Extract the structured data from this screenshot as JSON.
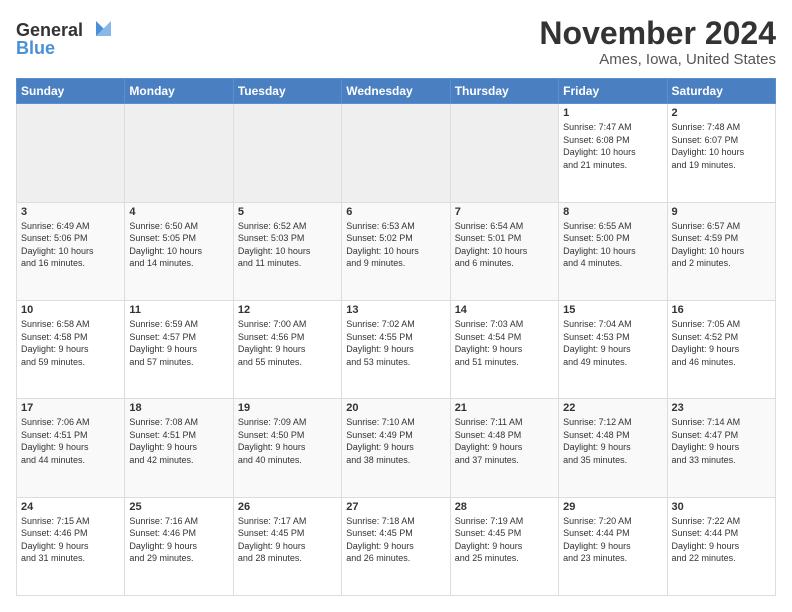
{
  "header": {
    "logo_line1": "General",
    "logo_line2": "Blue",
    "title": "November 2024",
    "subtitle": "Ames, Iowa, United States"
  },
  "calendar": {
    "headers": [
      "Sunday",
      "Monday",
      "Tuesday",
      "Wednesday",
      "Thursday",
      "Friday",
      "Saturday"
    ],
    "rows": [
      [
        {
          "day": "",
          "detail": ""
        },
        {
          "day": "",
          "detail": ""
        },
        {
          "day": "",
          "detail": ""
        },
        {
          "day": "",
          "detail": ""
        },
        {
          "day": "",
          "detail": ""
        },
        {
          "day": "1",
          "detail": "Sunrise: 7:47 AM\nSunset: 6:08 PM\nDaylight: 10 hours\nand 21 minutes."
        },
        {
          "day": "2",
          "detail": "Sunrise: 7:48 AM\nSunset: 6:07 PM\nDaylight: 10 hours\nand 19 minutes."
        }
      ],
      [
        {
          "day": "3",
          "detail": "Sunrise: 6:49 AM\nSunset: 5:06 PM\nDaylight: 10 hours\nand 16 minutes."
        },
        {
          "day": "4",
          "detail": "Sunrise: 6:50 AM\nSunset: 5:05 PM\nDaylight: 10 hours\nand 14 minutes."
        },
        {
          "day": "5",
          "detail": "Sunrise: 6:52 AM\nSunset: 5:03 PM\nDaylight: 10 hours\nand 11 minutes."
        },
        {
          "day": "6",
          "detail": "Sunrise: 6:53 AM\nSunset: 5:02 PM\nDaylight: 10 hours\nand 9 minutes."
        },
        {
          "day": "7",
          "detail": "Sunrise: 6:54 AM\nSunset: 5:01 PM\nDaylight: 10 hours\nand 6 minutes."
        },
        {
          "day": "8",
          "detail": "Sunrise: 6:55 AM\nSunset: 5:00 PM\nDaylight: 10 hours\nand 4 minutes."
        },
        {
          "day": "9",
          "detail": "Sunrise: 6:57 AM\nSunset: 4:59 PM\nDaylight: 10 hours\nand 2 minutes."
        }
      ],
      [
        {
          "day": "10",
          "detail": "Sunrise: 6:58 AM\nSunset: 4:58 PM\nDaylight: 9 hours\nand 59 minutes."
        },
        {
          "day": "11",
          "detail": "Sunrise: 6:59 AM\nSunset: 4:57 PM\nDaylight: 9 hours\nand 57 minutes."
        },
        {
          "day": "12",
          "detail": "Sunrise: 7:00 AM\nSunset: 4:56 PM\nDaylight: 9 hours\nand 55 minutes."
        },
        {
          "day": "13",
          "detail": "Sunrise: 7:02 AM\nSunset: 4:55 PM\nDaylight: 9 hours\nand 53 minutes."
        },
        {
          "day": "14",
          "detail": "Sunrise: 7:03 AM\nSunset: 4:54 PM\nDaylight: 9 hours\nand 51 minutes."
        },
        {
          "day": "15",
          "detail": "Sunrise: 7:04 AM\nSunset: 4:53 PM\nDaylight: 9 hours\nand 49 minutes."
        },
        {
          "day": "16",
          "detail": "Sunrise: 7:05 AM\nSunset: 4:52 PM\nDaylight: 9 hours\nand 46 minutes."
        }
      ],
      [
        {
          "day": "17",
          "detail": "Sunrise: 7:06 AM\nSunset: 4:51 PM\nDaylight: 9 hours\nand 44 minutes."
        },
        {
          "day": "18",
          "detail": "Sunrise: 7:08 AM\nSunset: 4:51 PM\nDaylight: 9 hours\nand 42 minutes."
        },
        {
          "day": "19",
          "detail": "Sunrise: 7:09 AM\nSunset: 4:50 PM\nDaylight: 9 hours\nand 40 minutes."
        },
        {
          "day": "20",
          "detail": "Sunrise: 7:10 AM\nSunset: 4:49 PM\nDaylight: 9 hours\nand 38 minutes."
        },
        {
          "day": "21",
          "detail": "Sunrise: 7:11 AM\nSunset: 4:48 PM\nDaylight: 9 hours\nand 37 minutes."
        },
        {
          "day": "22",
          "detail": "Sunrise: 7:12 AM\nSunset: 4:48 PM\nDaylight: 9 hours\nand 35 minutes."
        },
        {
          "day": "23",
          "detail": "Sunrise: 7:14 AM\nSunset: 4:47 PM\nDaylight: 9 hours\nand 33 minutes."
        }
      ],
      [
        {
          "day": "24",
          "detail": "Sunrise: 7:15 AM\nSunset: 4:46 PM\nDaylight: 9 hours\nand 31 minutes."
        },
        {
          "day": "25",
          "detail": "Sunrise: 7:16 AM\nSunset: 4:46 PM\nDaylight: 9 hours\nand 29 minutes."
        },
        {
          "day": "26",
          "detail": "Sunrise: 7:17 AM\nSunset: 4:45 PM\nDaylight: 9 hours\nand 28 minutes."
        },
        {
          "day": "27",
          "detail": "Sunrise: 7:18 AM\nSunset: 4:45 PM\nDaylight: 9 hours\nand 26 minutes."
        },
        {
          "day": "28",
          "detail": "Sunrise: 7:19 AM\nSunset: 4:45 PM\nDaylight: 9 hours\nand 25 minutes."
        },
        {
          "day": "29",
          "detail": "Sunrise: 7:20 AM\nSunset: 4:44 PM\nDaylight: 9 hours\nand 23 minutes."
        },
        {
          "day": "30",
          "detail": "Sunrise: 7:22 AM\nSunset: 4:44 PM\nDaylight: 9 hours\nand 22 minutes."
        }
      ]
    ]
  }
}
